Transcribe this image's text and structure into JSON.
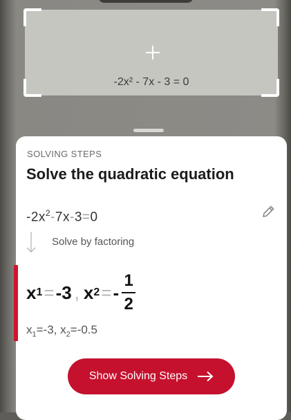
{
  "scanner": {
    "scanned_text": "-2x² - 7x - 3 = 0"
  },
  "sheet": {
    "eyebrow": "SOLVING STEPS",
    "title": "Solve the quadratic equation",
    "equation": {
      "coef_a": "-2x",
      "exp": "2",
      "op1": "-",
      "term_b": "7x",
      "op2": "-",
      "term_c": "3",
      "eq": "=",
      "rhs": "0"
    },
    "method_label": "Solve by factoring",
    "result": {
      "x": "x",
      "sub1": "1",
      "value1": "-3",
      "sub2": "2",
      "sign2": "-",
      "numerator": "1",
      "denominator": "2",
      "eq": "=",
      "comma": ","
    },
    "decimal": {
      "x": "x",
      "sub1": "1",
      "value1": "=-3",
      "comma": ",",
      "sub2": "2",
      "value2": "=-0.5"
    },
    "cta_label": "Show Solving Steps"
  },
  "colors": {
    "accent": "#c5112e",
    "sheet_bg": "#ffffff",
    "scan_bg": "#c4c6bf"
  },
  "icons": {
    "edit": "pencil-icon",
    "step": "down-arrow-icon",
    "cta": "arrow-right-icon",
    "focus": "crosshair-icon"
  }
}
